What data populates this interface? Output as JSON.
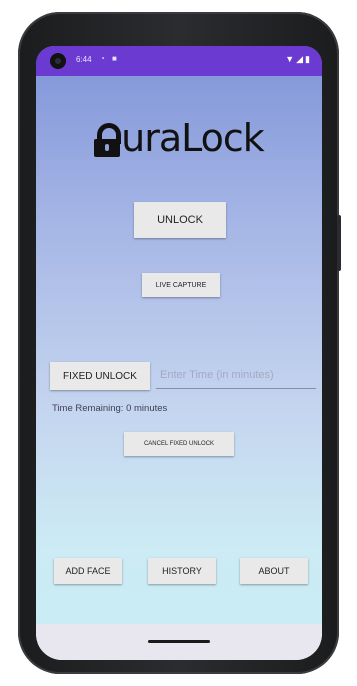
{
  "status_bar": {
    "time": "6:44",
    "left_icons": [
      "alarm-icon",
      "notification-icon"
    ],
    "right_icons": [
      "wifi-icon",
      "signal-icon",
      "battery-icon"
    ]
  },
  "logo": {
    "text": "uraLock",
    "icon": "padlock-icon"
  },
  "buttons": {
    "unlock": "UNLOCK",
    "live_capture": "LIVE CAPTURE",
    "fixed_unlock": "FIXED UNLOCK",
    "cancel_fixed_unlock": "CANCEL FIXED UNLOCK",
    "add_face": "ADD FACE",
    "history": "HISTORY",
    "about": "ABOUT"
  },
  "time_input": {
    "placeholder": "Enter Time (in minutes)",
    "value": ""
  },
  "time_remaining": "Time Remaining: 0 minutes",
  "colors": {
    "status_bar": "#6b3bd1",
    "button_bg": "#e9e9ea",
    "gradient_top": "#7f93d8",
    "gradient_bottom": "#c8ecf4"
  }
}
